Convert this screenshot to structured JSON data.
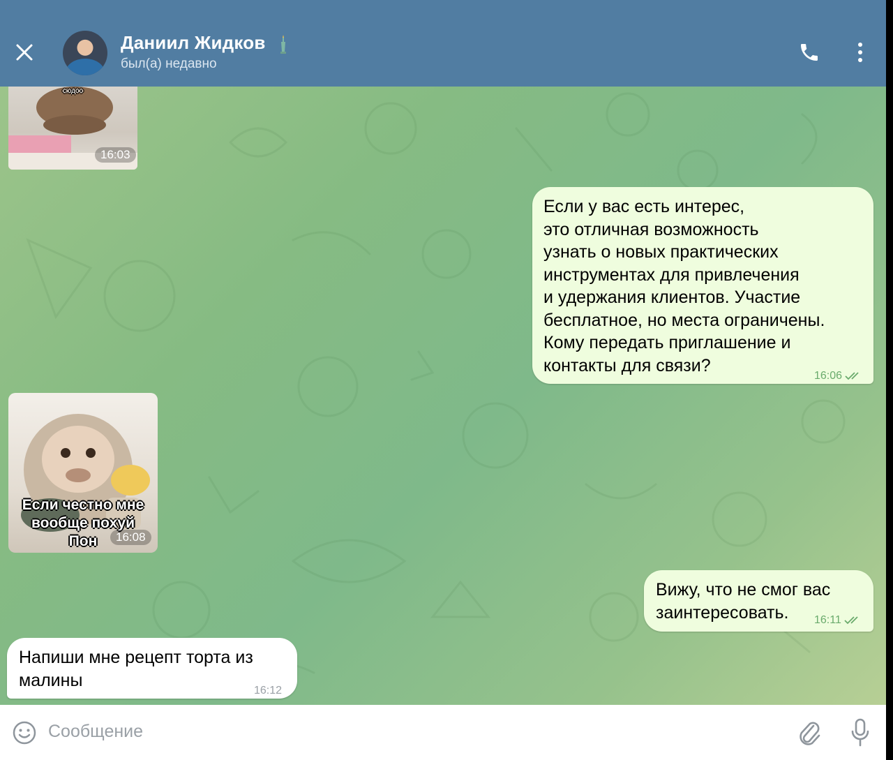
{
  "header": {
    "contact_name": "Даниил Жидков",
    "status": "был(а) недавно",
    "icons": {
      "close": "close-icon",
      "call": "phone-icon",
      "menu": "more-vertical-icon",
      "name_emoji": "statue-of-liberty-icon"
    }
  },
  "messages": [
    {
      "type": "sticker",
      "direction": "in",
      "caption_lines": [
        "сюдоо"
      ],
      "time": "16:03"
    },
    {
      "type": "text",
      "direction": "out",
      "text": "Если у вас есть интерес,\nэто отличная возможность\nузнать о новых практических\nинструментах для привлечения\nи удержания клиентов. Участие\nбесплатное, но места ограничены.\nКому передать приглашение и\nконтакты для связи?",
      "time": "16:06",
      "read": true
    },
    {
      "type": "sticker",
      "direction": "in",
      "caption_lines": [
        "Если честно мне",
        "вообще похуй",
        "Пон"
      ],
      "time": "16:08"
    },
    {
      "type": "text",
      "direction": "out",
      "text": "Вижу, что не смог вас\nзаинтересовать.",
      "time": "16:11",
      "read": true
    },
    {
      "type": "text",
      "direction": "in",
      "text": "Напиши мне рецепт торта из\nмалины",
      "time": "16:12"
    }
  ],
  "input": {
    "placeholder": "Сообщение",
    "icons": {
      "emoji": "smile-icon",
      "attach": "paperclip-icon",
      "voice": "microphone-icon"
    }
  }
}
